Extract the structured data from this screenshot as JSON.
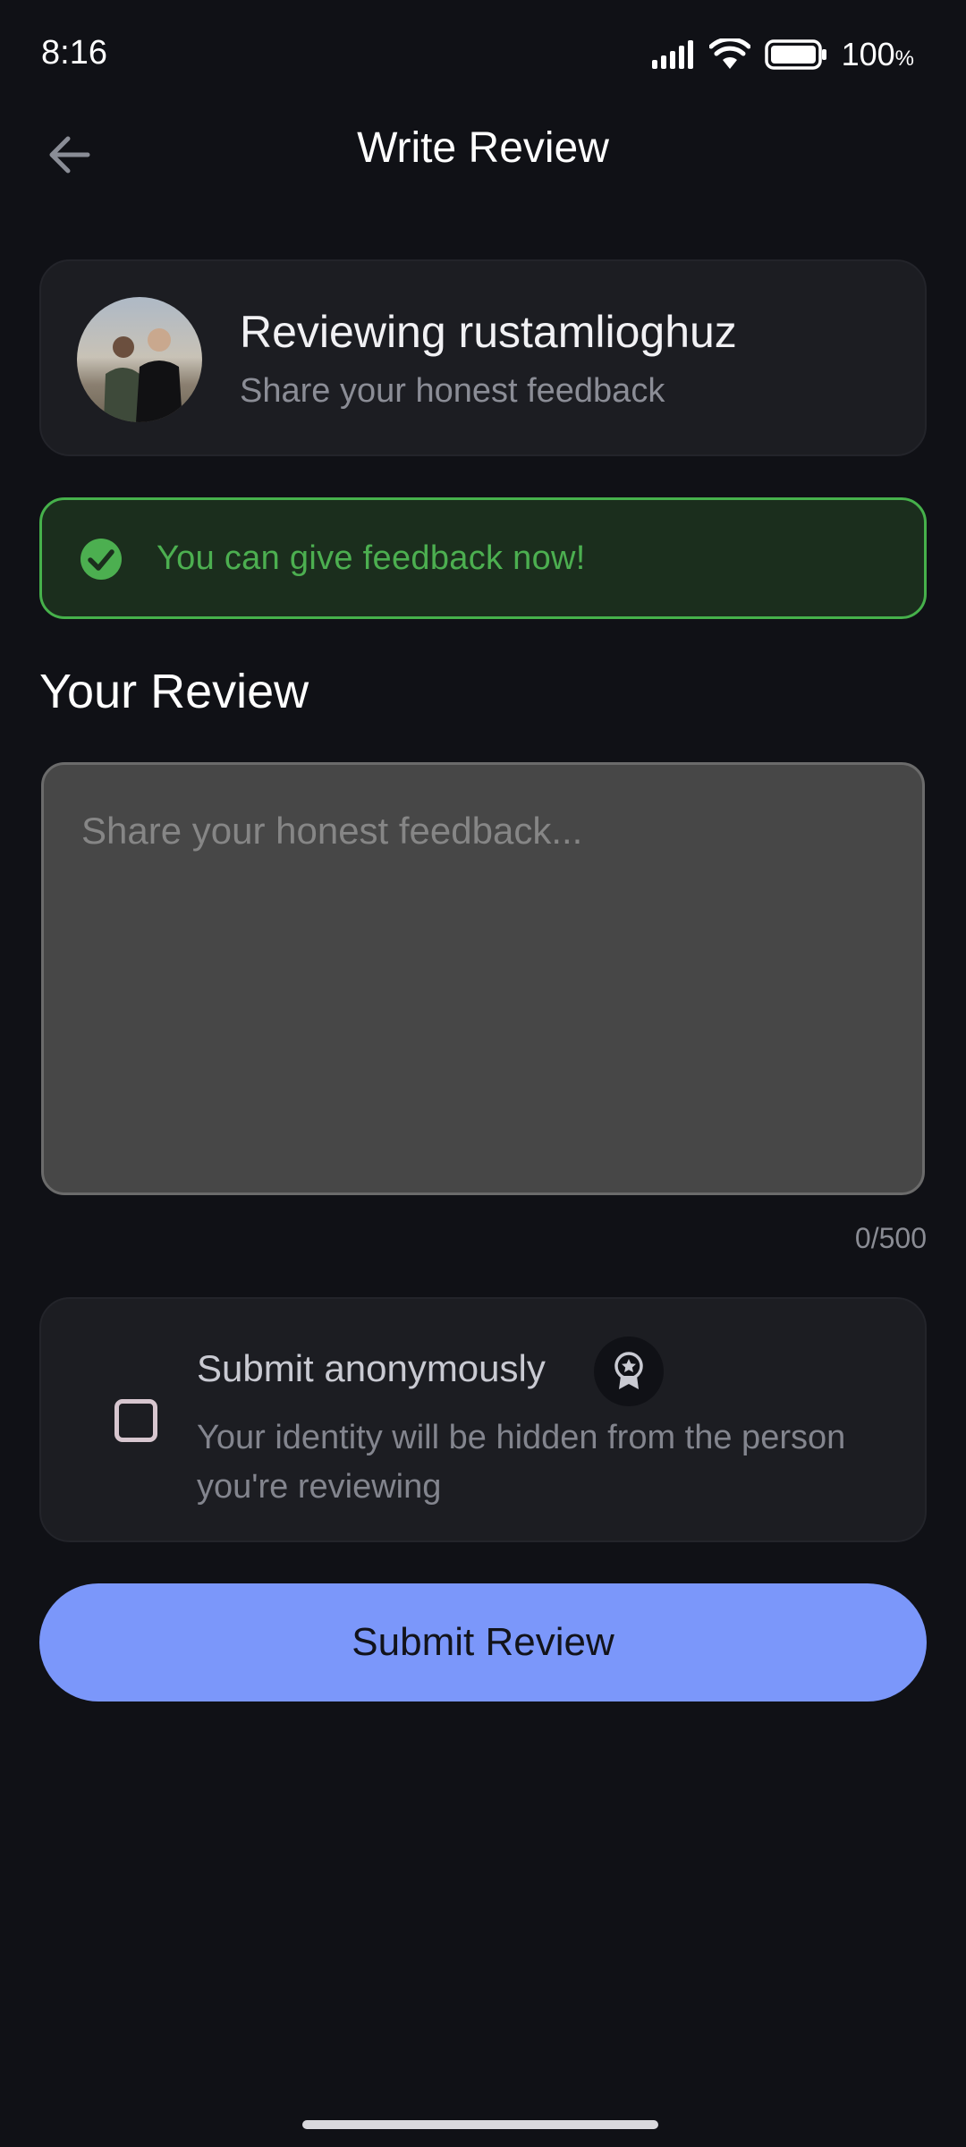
{
  "status_bar": {
    "time": "8:16",
    "battery_percent": "100",
    "battery_unit": "%",
    "icons": [
      "signal-icon",
      "wifi-icon",
      "battery-icon"
    ]
  },
  "app_bar": {
    "title": "Write Review",
    "back_icon": "arrow-left-icon"
  },
  "review_card": {
    "title": "Reviewing rustamlioghuz",
    "subtitle": "Share your honest feedback"
  },
  "banner": {
    "text": "You can give feedback now!",
    "icon": "check-circle-icon",
    "color": "#4caf50",
    "background": "#1b2e1d"
  },
  "section": {
    "title": "Your Review"
  },
  "review_input": {
    "value": "",
    "placeholder": "Share your honest feedback...",
    "counter": "0/500"
  },
  "anonymous": {
    "title": "Submit anonymously",
    "subtitle": "Your identity will be hidden from the person you're reviewing",
    "checked": false,
    "icon": "award-badge-icon"
  },
  "submit": {
    "label": "Submit Review",
    "color": "#7b97fa"
  },
  "theme": {
    "background": "#101116",
    "card": "#1c1d22"
  }
}
